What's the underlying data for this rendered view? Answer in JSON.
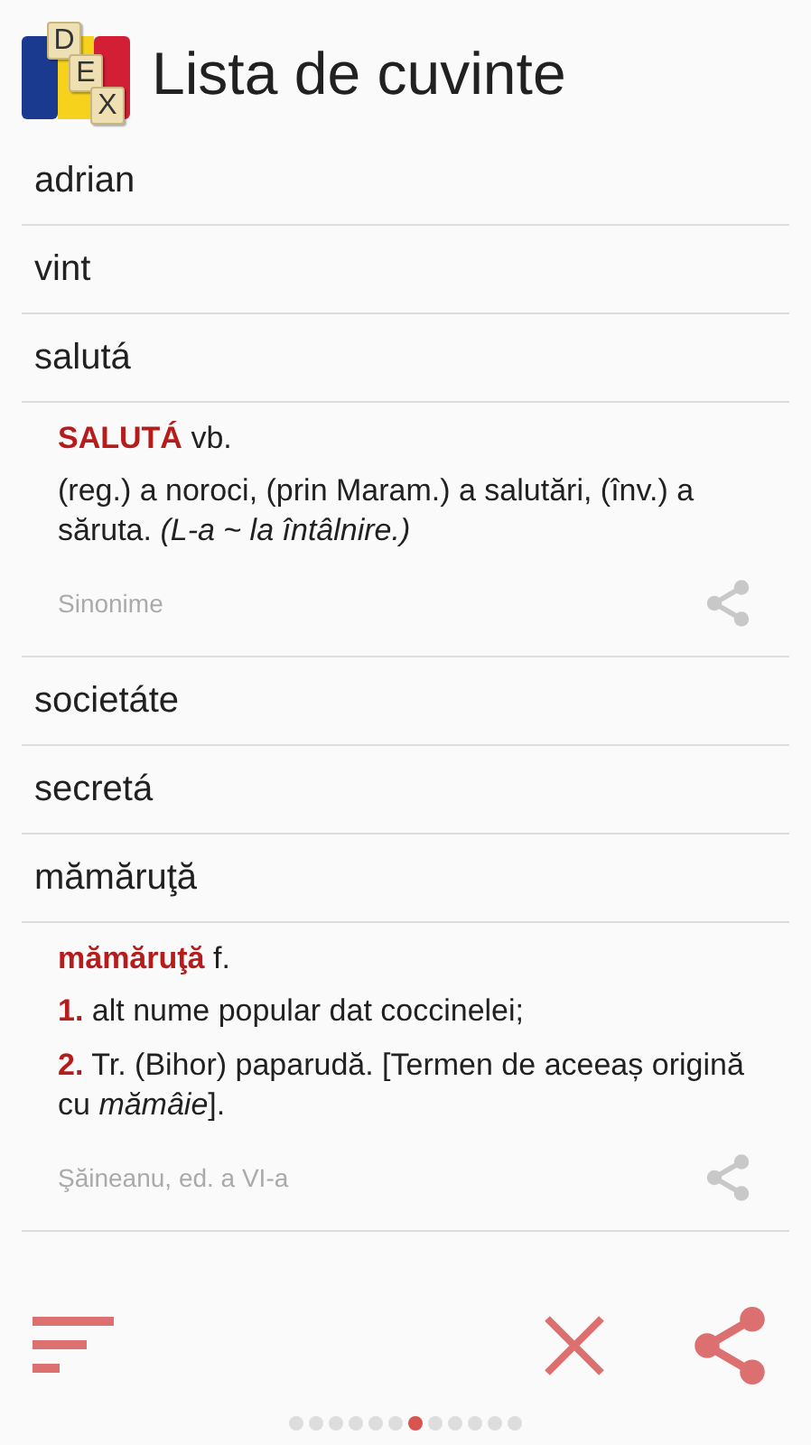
{
  "header": {
    "logo_letters": [
      "D",
      "E",
      "X"
    ],
    "title": "Lista de cuvinte"
  },
  "items": [
    {
      "kind": "word",
      "text": "adrian"
    },
    {
      "kind": "word",
      "text": "vint"
    },
    {
      "kind": "word",
      "text": "salutá"
    },
    {
      "kind": "definition",
      "headword": "SALUTÁ",
      "pos": "vb.",
      "body": "(reg.) a noroci, (prin Maram.) a salutări, (înv.) a săruta. *(L-a ~ la întâlnire.)*",
      "source": "Sinonime"
    },
    {
      "kind": "word",
      "text": "societáte"
    },
    {
      "kind": "word",
      "text": "secretá"
    },
    {
      "kind": "word",
      "text": "mămăruţă"
    },
    {
      "kind": "definition",
      "headword": "mămăruţă",
      "pos": "f.",
      "senses": [
        {
          "number": "1.",
          "text": "alt nume popular dat coccinelei;"
        },
        {
          "number": "2.",
          "text": "Tr. (Bihor) paparudă. [Termen de aceeaș origină cu *mămâie*]."
        }
      ],
      "source": "Şăineanu, ed. a VI-a"
    }
  ],
  "pager": [
    {
      "selected": false
    },
    {
      "selected": false
    },
    {
      "selected": false
    },
    {
      "selected": false
    },
    {
      "selected": false
    },
    {
      "selected": false
    },
    {
      "selected": true
    },
    {
      "selected": false
    },
    {
      "selected": false
    },
    {
      "selected": false
    },
    {
      "selected": false
    },
    {
      "selected": false
    }
  ]
}
